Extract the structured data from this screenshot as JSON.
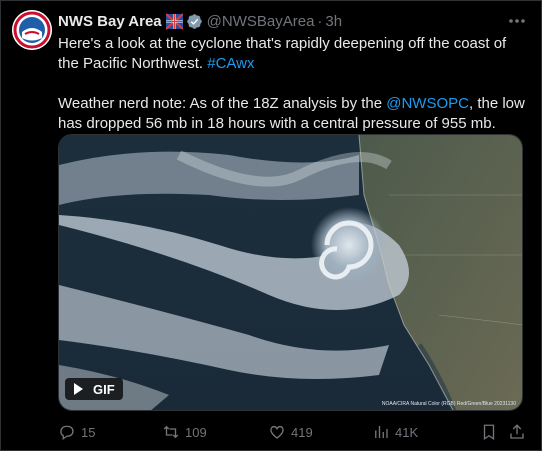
{
  "author": {
    "name": "NWS Bay Area",
    "handle": "@NWSBayArea",
    "separator": "·",
    "time": "3h"
  },
  "tweet": {
    "line1_text": "Here's a look at the cyclone that's rapidly deepening off the coast of the Pacific Northwest. ",
    "hashtag": "#CAwx",
    "line2_prefix": "Weather nerd note: As of the 18Z analysis by the ",
    "mention": "@NWSOPC",
    "line2_suffix": ", the low has dropped 56 mb in 18 hours with a central pressure of 955 mb."
  },
  "media": {
    "badge_label": "GIF",
    "caption": "NOAA/CIRA Natural Color (RGB) Red/Green/Blue 20231130"
  },
  "actions": {
    "replies": "15",
    "reposts": "109",
    "likes": "419",
    "views": "41K"
  },
  "icons": [
    "nws-logo-icon",
    "flag-icon",
    "verified-icon",
    "more-icon",
    "play-icon",
    "reply-icon",
    "repost-icon",
    "like-icon",
    "views-icon",
    "bookmark-icon",
    "share-icon"
  ],
  "colors": {
    "accent": "#1d9bf0",
    "muted": "#71767b",
    "text": "#e7e9ea",
    "background": "#000000"
  }
}
